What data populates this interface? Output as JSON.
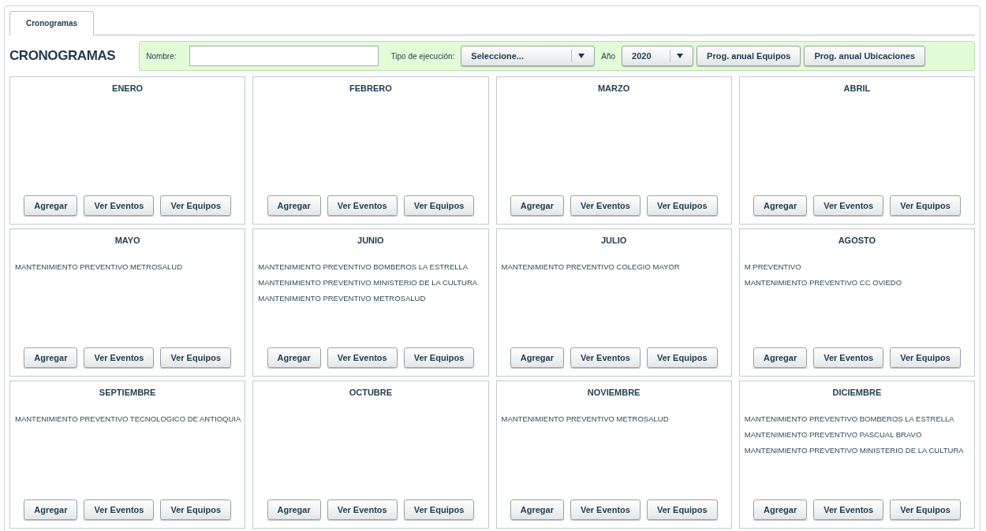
{
  "tabs": [
    {
      "label": "Cronogramas",
      "selected": true
    }
  ],
  "heading": "CRONOGRAMAS",
  "filters": {
    "name_label": "Nombre:",
    "type_label": "Tipo de ejecución:",
    "type_value": "Seleccione...",
    "year_label": "Año",
    "year_value": "2020",
    "buttons": [
      "Prog. anual Equipos",
      "Prog. anual Ubicaciones"
    ]
  },
  "months": [
    {
      "name": "ENERO",
      "buttons": [
        "Agregar",
        "Ver Eventos",
        "Ver Equipos"
      ]
    },
    {
      "name": "FEBRERO",
      "buttons": [
        "Agregar",
        "Ver Eventos",
        "Ver Equipos"
      ]
    },
    {
      "name": "MARZO",
      "buttons": [
        "Agregar",
        "Ver Eventos",
        "Ver Equipos"
      ]
    },
    {
      "name": "ABRIL",
      "buttons": [
        "Agregar",
        "Ver Eventos",
        "Ver Equipos"
      ]
    },
    {
      "name": "MAYO",
      "events": [
        "MANTENIMIENTO PREVENTIVO METROSALUD"
      ],
      "buttons": [
        "Agregar",
        "Ver Eventos",
        "Ver Equipos"
      ]
    },
    {
      "name": "JUNIO",
      "events": [
        "MANTENIMIENTO PREVENTIVO BOMBEROS LA ESTRELLA",
        "MANTENIMIENTO PREVENTIVO MINISTERIO DE LA CULTURA",
        "MANTENIMIENTO PREVENTIVO METROSALUD"
      ],
      "buttons": [
        "Agregar",
        "Ver Eventos",
        "Ver Equipos"
      ]
    },
    {
      "name": "JULIO",
      "events": [
        "MANTENIMIENTO PREVENTIVO COLEGIO MAYOR"
      ],
      "buttons": [
        "Agregar",
        "Ver Eventos",
        "Ver Equipos"
      ]
    },
    {
      "name": "AGOSTO",
      "events": [
        "M PREVENTIVO",
        "MANTENIMIENTO PREVENTIVO CC OVIEDO"
      ],
      "buttons": [
        "Agregar",
        "Ver Eventos",
        "Ver Equipos"
      ]
    },
    {
      "name": "SEPTIEMBRE",
      "events": [
        "MANTENIMIENTO PREVENTIVO TECNOLOGICO DE ANTIOQUIA"
      ],
      "buttons": [
        "Agregar",
        "Ver Eventos",
        "Ver Equipos"
      ]
    },
    {
      "name": "OCTUBRE",
      "buttons": [
        "Agregar",
        "Ver Eventos",
        "Ver Equipos"
      ]
    },
    {
      "name": "NOVIEMBRE",
      "events": [
        "MANTENIMIENTO PREVENTIVO METROSALUD"
      ],
      "buttons": [
        "Agregar",
        "Ver Eventos",
        "Ver Equipos"
      ]
    },
    {
      "name": "DICIEMBRE",
      "events": [
        "MANTENIMIENTO PREVENTIVO BOMBEROS LA ESTRELLA",
        "MANTENIMIENTO PREVENTIVO PASCUAL BRAVO",
        "MANTENIMIENTO PREVENTIVO MINISTERIO DE LA CULTURA"
      ],
      "buttons": [
        "Agregar",
        "Ver Eventos",
        "Ver Equipos"
      ]
    }
  ]
}
